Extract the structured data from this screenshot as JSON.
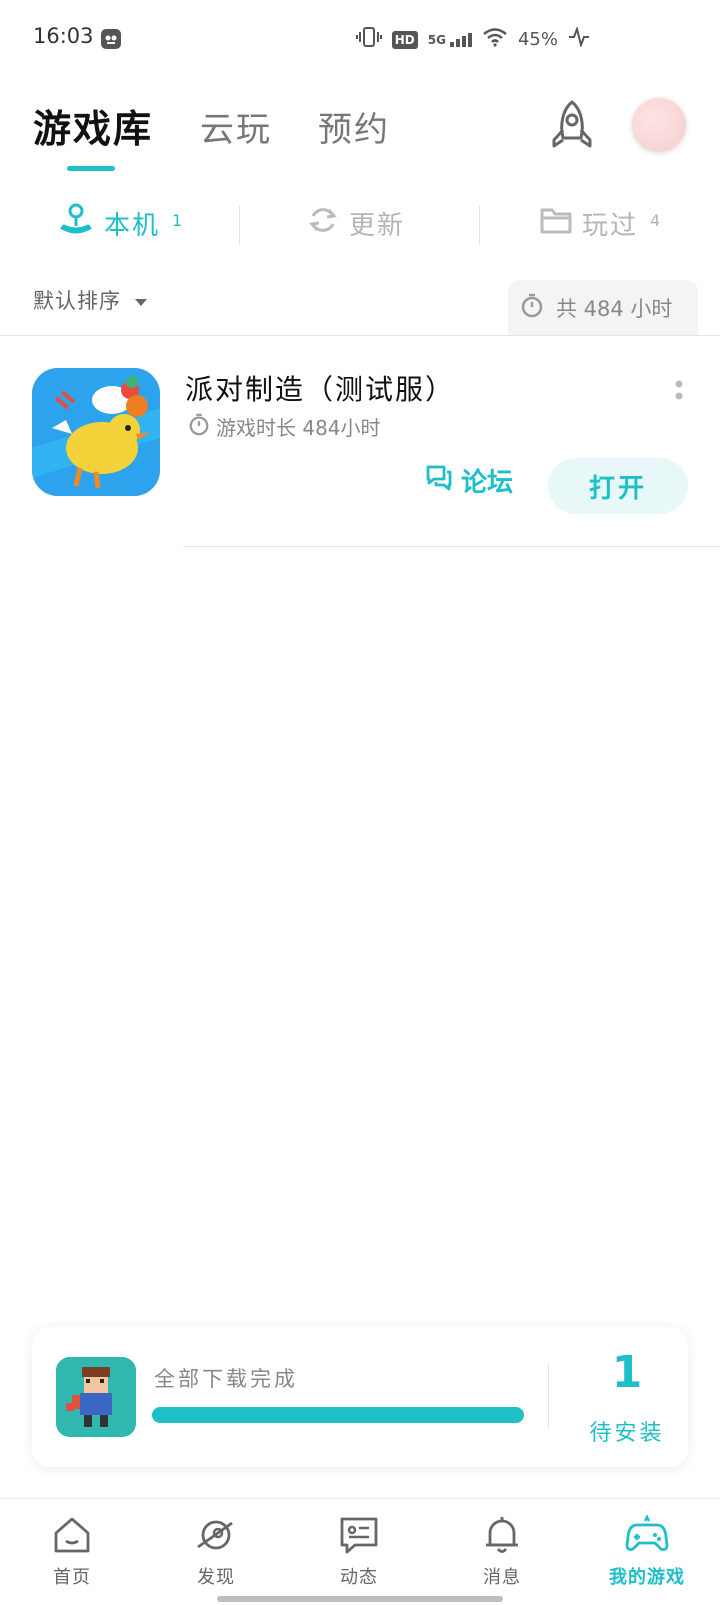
{
  "status_bar": {
    "time": "16:03",
    "network": "5G",
    "hd": "HD",
    "battery": "45%"
  },
  "header": {
    "tabs": [
      {
        "label": "游戏库",
        "active": true
      },
      {
        "label": "云玩",
        "active": false
      },
      {
        "label": "预约",
        "active": false
      }
    ],
    "icons": [
      "rocket-icon",
      "avatar"
    ]
  },
  "sub_tabs": [
    {
      "label": "本机",
      "count": "1",
      "active": true,
      "icon": "joystick-icon"
    },
    {
      "label": "更新",
      "count": "",
      "active": false,
      "icon": "refresh-icon"
    },
    {
      "label": "玩过",
      "count": "4",
      "active": false,
      "icon": "folder-icon"
    }
  ],
  "sort": {
    "label": "默认排序",
    "total_time": "共 484 小时"
  },
  "games": [
    {
      "title": "派对制造（测试服）",
      "playtime": "游戏时长 484小时",
      "forum_label": "论坛",
      "open_label": "打开"
    }
  ],
  "download_card": {
    "status": "全部下载完成",
    "progress": 1.0,
    "count": "1",
    "pending_label": "待安装"
  },
  "bottom_nav": [
    {
      "label": "首页",
      "icon": "home-icon",
      "active": false
    },
    {
      "label": "发现",
      "icon": "planet-icon",
      "active": false
    },
    {
      "label": "动态",
      "icon": "chat-icon",
      "active": false
    },
    {
      "label": "消息",
      "icon": "bell-icon",
      "active": false
    },
    {
      "label": "我的游戏",
      "icon": "gamepad-icon",
      "active": true
    }
  ],
  "colors": {
    "accent": "#1fbfc7",
    "text_dark": "#111111",
    "text_muted": "#888888"
  }
}
